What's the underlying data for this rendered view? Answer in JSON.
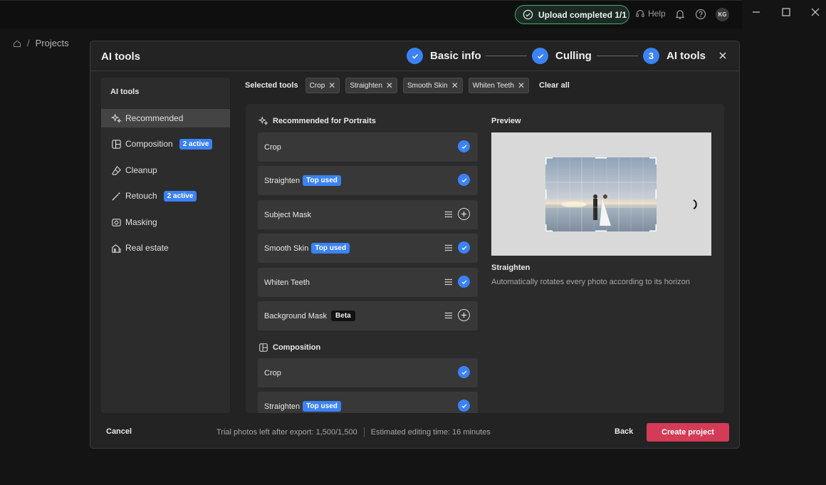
{
  "titlebar": {
    "upload_status": "Upload completed 1/1",
    "help_label": "Help",
    "avatar_initials": "KG"
  },
  "breadcrumb": {
    "home_icon": "home-icon",
    "separator": "/",
    "current": "Projects"
  },
  "modal": {
    "title": "AI tools",
    "steps": [
      {
        "label": "Basic info",
        "state": "done"
      },
      {
        "label": "Culling",
        "state": "done"
      },
      {
        "label": "AI tools",
        "number": "3",
        "state": "current"
      }
    ]
  },
  "sidebar": {
    "title": "AI tools",
    "items": [
      {
        "label": "Recommended",
        "icon": "sparkle-icon",
        "active": true
      },
      {
        "label": "Composition",
        "icon": "composition-icon",
        "badge": "2 active"
      },
      {
        "label": "Cleanup",
        "icon": "eraser-icon"
      },
      {
        "label": "Retouch",
        "icon": "wand-icon",
        "badge": "2 active"
      },
      {
        "label": "Masking",
        "icon": "mask-icon"
      },
      {
        "label": "Real estate",
        "icon": "building-icon"
      }
    ]
  },
  "selected": {
    "label": "Selected tools",
    "chips": [
      "Crop",
      "Straighten",
      "Smooth Skin",
      "Whiten Teeth"
    ],
    "clear_all": "Clear all"
  },
  "sections": [
    {
      "title": "Recommended for Portraits",
      "tools": [
        {
          "label": "Crop",
          "selected": true
        },
        {
          "label": "Straighten",
          "badge": "Top used",
          "selected": true
        },
        {
          "label": "Subject Mask",
          "settings": true,
          "selected": false
        },
        {
          "label": "Smooth Skin",
          "badge": "Top used",
          "settings": true,
          "selected": true
        },
        {
          "label": "Whiten Teeth",
          "settings": true,
          "selected": true
        },
        {
          "label": "Background Mask",
          "badge_dark": "Beta",
          "settings": true,
          "selected": false
        }
      ]
    },
    {
      "title": "Composition",
      "tools": [
        {
          "label": "Crop",
          "selected": true
        },
        {
          "label": "Straighten",
          "badge": "Top used",
          "selected": true
        }
      ]
    }
  ],
  "preview": {
    "title": "Preview",
    "tool_name": "Straighten",
    "description": "Automatically rotates every photo according to its horizon"
  },
  "footer": {
    "cancel": "Cancel",
    "trial_text": "Trial photos left after export: 1,500/1,500",
    "estimate_text": "Estimated editing time: 16 minutes",
    "back": "Back",
    "create": "Create project"
  },
  "colors": {
    "accent": "#3b82f6",
    "primary_button": "#d33b57",
    "success": "#3fae7a"
  }
}
